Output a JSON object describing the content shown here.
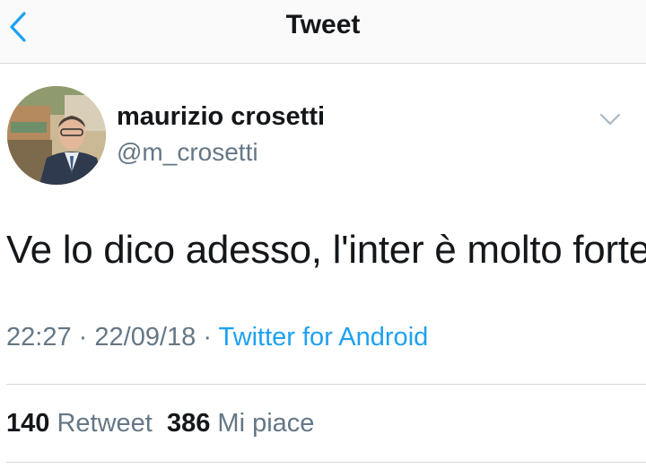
{
  "header": {
    "title": "Tweet",
    "back_icon": "chevron-left-icon"
  },
  "tweet": {
    "author": {
      "display_name": "maurizio crosetti",
      "handle": "@m_crosetti"
    },
    "menu_icon": "chevron-down-icon",
    "text": "Ve lo dico adesso, l'inter è molto forte",
    "time": "22:27",
    "separator": "·",
    "date": "22/09/18",
    "source": "Twitter for Android"
  },
  "stats": {
    "retweets_count": "140",
    "retweets_label": "Retweet",
    "likes_count": "386",
    "likes_label": "Mi piace"
  },
  "colors": {
    "accent": "#1da1f2",
    "text_primary": "#14171a",
    "text_secondary": "#657786",
    "divider": "#d6d9dc"
  }
}
